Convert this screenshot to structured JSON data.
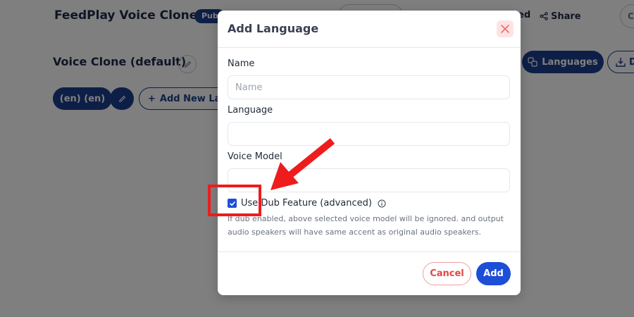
{
  "background": {
    "app_title": "FeedPlay Voice Clone",
    "status_badge": "Pub",
    "header_partial_text": "ed",
    "share_label": "Share",
    "circle_button_letter": "C",
    "section_title": "Voice Clone (default)",
    "languages_button": "Languages",
    "download_button": "D",
    "language_chip": "(en) (en)",
    "add_new_language": "Add New Lang"
  },
  "modal": {
    "title": "Add Language",
    "fields": {
      "name": {
        "label": "Name",
        "placeholder": "Name",
        "value": ""
      },
      "language": {
        "label": "Language",
        "value": ""
      },
      "voice_model": {
        "label": "Voice Model",
        "value": ""
      }
    },
    "dub_checkbox": {
      "label": "Use Dub Feature (advanced)",
      "checked": true,
      "help_text": "If dub enabled, above selected voice model will be ignored. and output audio speakers will have same accent as original audio speakers."
    },
    "cancel_label": "Cancel",
    "add_label": "Add"
  },
  "colors": {
    "primary": "#1d4ed8",
    "navy": "#1d3f8f",
    "danger": "#e64545",
    "annotation": "#ee1c1c"
  },
  "icons": {
    "share": "share-icon",
    "edit": "pencil-icon",
    "languages": "languages-icon",
    "download": "download-icon",
    "close": "close-icon",
    "check": "check-icon",
    "info": "info-icon"
  }
}
